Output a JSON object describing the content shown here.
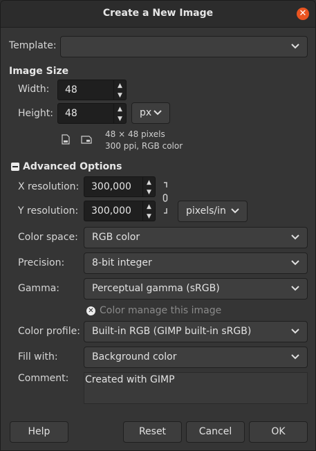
{
  "window": {
    "title": "Create a New Image"
  },
  "template": {
    "label": "Template:",
    "value": ""
  },
  "image_size": {
    "heading": "Image Size",
    "width_label": "Width:",
    "width_value": "48",
    "height_label": "Height:",
    "height_value": "48",
    "unit": "px",
    "info_line1": "48 × 48 pixels",
    "info_line2": "300 ppi, RGB color"
  },
  "advanced": {
    "heading": "Advanced Options",
    "xres_label": "X resolution:",
    "xres_value": "300,000",
    "yres_label": "Y resolution:",
    "yres_value": "300,000",
    "res_unit": "pixels/in",
    "colorspace_label": "Color space:",
    "colorspace_value": "RGB color",
    "precision_label": "Precision:",
    "precision_value": "8-bit integer",
    "gamma_label": "Gamma:",
    "gamma_value": "Perceptual gamma (sRGB)",
    "color_manage_label": "Color manage this image",
    "profile_label": "Color profile:",
    "profile_value": "Built-in RGB (GIMP built-in sRGB)",
    "fill_label": "Fill with:",
    "fill_value": "Background color",
    "comment_label": "Comment:",
    "comment_value": "Created with GIMP"
  },
  "buttons": {
    "help": "Help",
    "reset": "Reset",
    "cancel": "Cancel",
    "ok": "OK"
  }
}
